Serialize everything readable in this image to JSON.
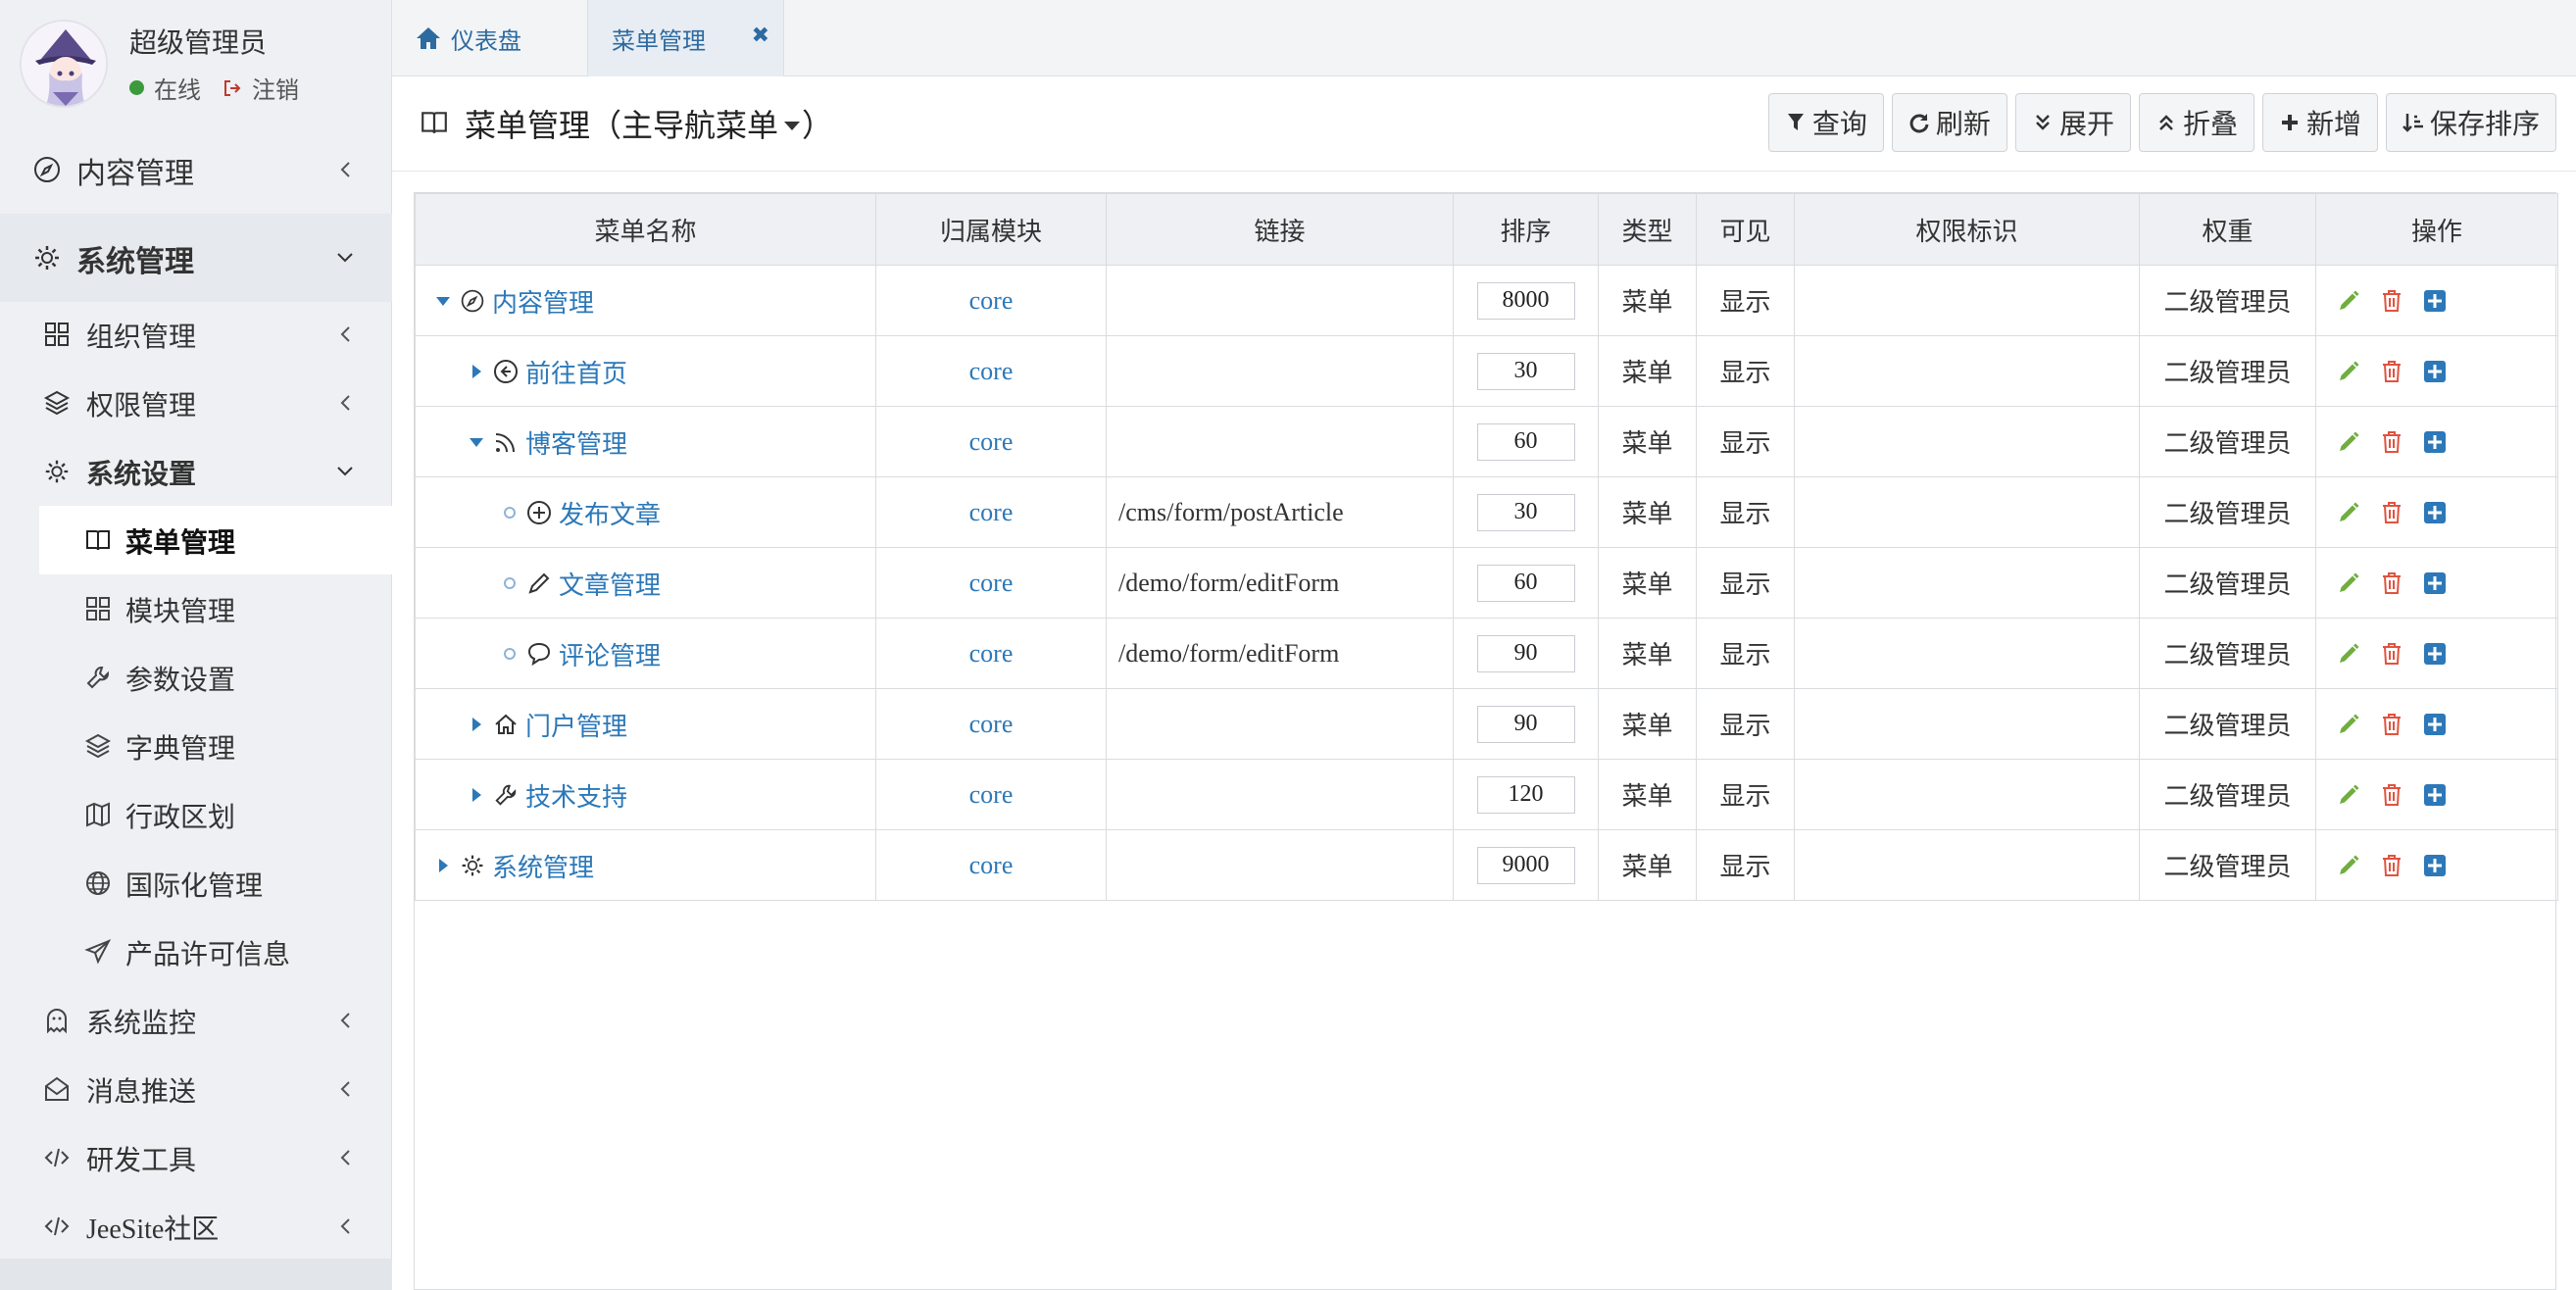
{
  "user": {
    "name": "超级管理员",
    "status": "在线",
    "logout": "注销"
  },
  "sidebar": {
    "content_mgmt": "内容管理",
    "system_mgmt": "系统管理",
    "org_mgmt": "组织管理",
    "perm_mgmt": "权限管理",
    "sys_settings": "系统设置",
    "menu_mgmt": "菜单管理",
    "module_mgmt": "模块管理",
    "param_settings": "参数设置",
    "dict_mgmt": "字典管理",
    "region": "行政区划",
    "i18n": "国际化管理",
    "license": "产品许可信息",
    "monitor": "系统监控",
    "push": "消息推送",
    "devtools": "研发工具",
    "community": "JeeSite社区"
  },
  "tabs": {
    "dashboard": "仪表盘",
    "menu": "菜单管理"
  },
  "header": {
    "title": "菜单管理（主导航菜单",
    "title_end": "）"
  },
  "toolbar": {
    "query": "查询",
    "refresh": "刷新",
    "expand": "展开",
    "collapse": "折叠",
    "add": "新增",
    "save_sort": "保存排序"
  },
  "table": {
    "columns": [
      "菜单名称",
      "归属模块",
      "链接",
      "排序",
      "类型",
      "可见",
      "权限标识",
      "权重",
      "操作"
    ],
    "rows": [
      {
        "name": "内容管理",
        "module": "core",
        "link": "",
        "sort": "8000",
        "type": "菜单",
        "visible": "显示",
        "perm": "",
        "weight": "二级管理员"
      },
      {
        "name": "前往首页",
        "module": "core",
        "link": "",
        "sort": "30",
        "type": "菜单",
        "visible": "显示",
        "perm": "",
        "weight": "二级管理员"
      },
      {
        "name": "博客管理",
        "module": "core",
        "link": "",
        "sort": "60",
        "type": "菜单",
        "visible": "显示",
        "perm": "",
        "weight": "二级管理员"
      },
      {
        "name": "发布文章",
        "module": "core",
        "link": "/cms/form/postArticle",
        "sort": "30",
        "type": "菜单",
        "visible": "显示",
        "perm": "",
        "weight": "二级管理员"
      },
      {
        "name": "文章管理",
        "module": "core",
        "link": "/demo/form/editForm",
        "sort": "60",
        "type": "菜单",
        "visible": "显示",
        "perm": "",
        "weight": "二级管理员"
      },
      {
        "name": "评论管理",
        "module": "core",
        "link": "/demo/form/editForm",
        "sort": "90",
        "type": "菜单",
        "visible": "显示",
        "perm": "",
        "weight": "二级管理员"
      },
      {
        "name": "门户管理",
        "module": "core",
        "link": "",
        "sort": "90",
        "type": "菜单",
        "visible": "显示",
        "perm": "",
        "weight": "二级管理员"
      },
      {
        "name": "技术支持",
        "module": "core",
        "link": "",
        "sort": "120",
        "type": "菜单",
        "visible": "显示",
        "perm": "",
        "weight": "二级管理员"
      },
      {
        "name": "系统管理",
        "module": "core",
        "link": "",
        "sort": "9000",
        "type": "菜单",
        "visible": "显示",
        "perm": "",
        "weight": "二级管理员"
      }
    ]
  },
  "colors": {
    "link": "#2c78b8",
    "edit": "#6fae3f",
    "delete": "#e0533f",
    "add": "#2c78b8",
    "online": "#3c9a3c"
  }
}
